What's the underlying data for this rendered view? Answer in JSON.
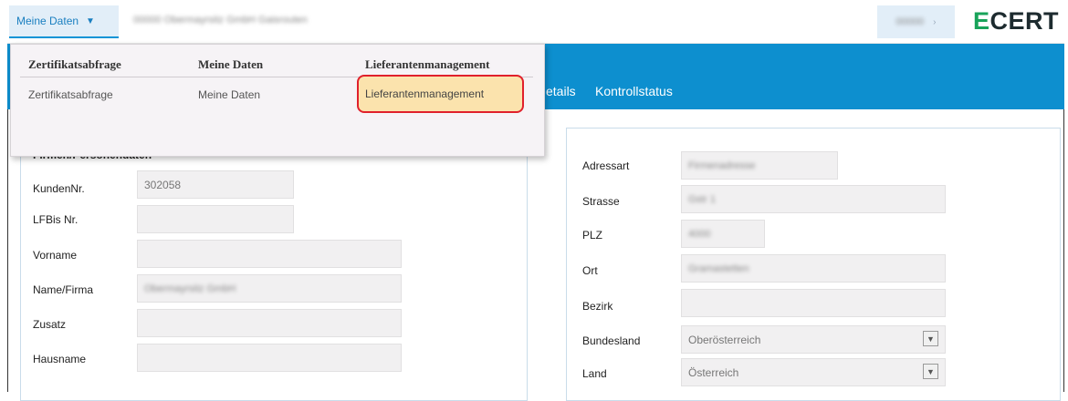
{
  "header": {
    "menu_label": "Meine Daten",
    "company": "00000 Obermayrsitz GmbH Gaisrouten",
    "user": "00000",
    "logo_brand": "ECERT"
  },
  "tabs": {
    "details_partial": "etails",
    "kontrollstatus": "Kontrollstatus"
  },
  "dropdown": {
    "columns": [
      {
        "heading": "Zertifikatsabfrage",
        "item": "Zertifikatsabfrage"
      },
      {
        "heading": "Meine Daten",
        "item": "Meine Daten"
      },
      {
        "heading": "Lieferantenmanagement",
        "item": "Lieferantenmanagement"
      }
    ]
  },
  "left_panel": {
    "title": "Firmen/Personendaten",
    "fields": [
      {
        "label": "KundenNr.",
        "value": "302058"
      },
      {
        "label": "LFBis Nr.",
        "value": ""
      },
      {
        "label": "Vorname",
        "value": ""
      },
      {
        "label": "Name/Firma",
        "value": "Obermayrsitz GmbH"
      },
      {
        "label": "Zusatz",
        "value": ""
      },
      {
        "label": "Hausname",
        "value": ""
      }
    ]
  },
  "right_panel": {
    "fields": [
      {
        "label": "Adressart",
        "value": "Firmenadresse"
      },
      {
        "label": "Strasse",
        "value": "Gstr 1"
      },
      {
        "label": "PLZ",
        "value": "4000"
      },
      {
        "label": "Ort",
        "value": "Gramastetten"
      },
      {
        "label": "Bezirk",
        "value": ""
      },
      {
        "label": "Bundesland",
        "value": "Oberösterreich"
      },
      {
        "label": "Land",
        "value": "Österreich"
      }
    ]
  },
  "colors": {
    "accent_blue": "#0d8fcf",
    "highlight_fill": "#fbe3ad",
    "highlight_border": "#e0202b",
    "logo_green": "#19a35a"
  }
}
